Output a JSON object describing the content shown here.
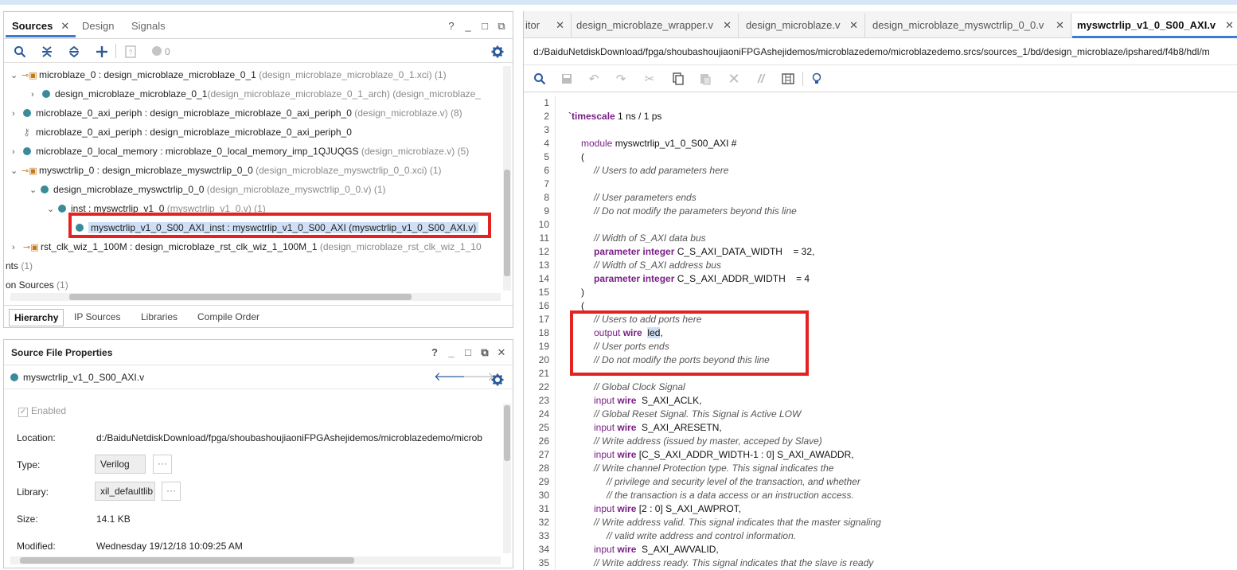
{
  "sources_panel": {
    "tabs": [
      {
        "label": "Sources",
        "active": true
      },
      {
        "label": "Design",
        "active": false
      },
      {
        "label": "Signals",
        "active": false
      }
    ],
    "window_buttons": [
      "?",
      "_",
      "□",
      "⧉"
    ],
    "toolbar": {
      "badge_count": "0"
    },
    "tree": [
      {
        "name": "microblaze_0 : design_microblaze_microblaze_0_1",
        "detail": " (design_microblaze_microblaze_0_1.xci) (1)"
      },
      {
        "name": "design_microblaze_microblaze_0_1",
        "detail": "(design_microblaze_microblaze_0_1_arch) (design_microblaze_"
      },
      {
        "name": "microblaze_0_axi_periph : design_microblaze_microblaze_0_axi_periph_0",
        "detail": " (design_microblaze.v) (8)"
      },
      {
        "name": "microblaze_0_axi_periph : design_microblaze_microblaze_0_axi_periph_0",
        "detail": ""
      },
      {
        "name": "microblaze_0_local_memory : microblaze_0_local_memory_imp_1QJUQGS",
        "detail": " (design_microblaze.v) (5)"
      },
      {
        "name": "myswctrlip_0 : design_microblaze_myswctrlip_0_0",
        "detail": " (design_microblaze_myswctrlip_0_0.xci) (1)"
      },
      {
        "name": "design_microblaze_myswctrlip_0_0",
        "detail": " (design_microblaze_myswctrlip_0_0.v) (1)"
      },
      {
        "name": "inst : myswctrlip_v1_0",
        "detail": " (myswctrlip_v1_0.v) (1)"
      },
      {
        "name": "myswctrlip_v1_0_S00_AXI_inst : myswctrlip_v1_0_S00_AXI (myswctrlip_v1_0_S00_AXI.v)",
        "detail": ""
      },
      {
        "name": "rst_clk_wiz_1_100M : design_microblaze_rst_clk_wiz_1_100M_1",
        "detail": " (design_microblaze_rst_clk_wiz_1_10"
      },
      {
        "name": "nts",
        "detail": " (1)"
      },
      {
        "name": "on Sources",
        "detail": " (1)"
      }
    ],
    "bottom_tabs": [
      {
        "label": "Hierarchy",
        "active": true
      },
      {
        "label": "IP Sources",
        "active": false
      },
      {
        "label": "Libraries",
        "active": false
      },
      {
        "label": "Compile Order",
        "active": false
      }
    ]
  },
  "properties_panel": {
    "title": "Source File Properties",
    "window_buttons": [
      "?",
      "_",
      "□",
      "⧉",
      "✕"
    ],
    "file_name": "myswctrlip_v1_0_S00_AXI.v",
    "enabled_label": "Enabled",
    "rows": [
      {
        "label": "Location:",
        "value": "d:/BaiduNetdiskDownload/fpga/shoubashoujiaoniFPGAshejidemos/microblazedemo/microb"
      },
      {
        "label": "Type:",
        "value": "Verilog"
      },
      {
        "label": "Library:",
        "value": "xil_defaultlib"
      },
      {
        "label": "Size:",
        "value": "14.1 KB"
      },
      {
        "label": "Modified:",
        "value": "Wednesday 19/12/18 10:09:25 AM"
      }
    ],
    "more_button": "···"
  },
  "editor": {
    "tabs": [
      {
        "label": "itor",
        "active": false
      },
      {
        "label": "design_microblaze_wrapper.v",
        "active": false
      },
      {
        "label": "design_microblaze.v",
        "active": false
      },
      {
        "label": "design_microblaze_myswctrlip_0_0.v",
        "active": false
      },
      {
        "label": "myswctrlip_v1_0_S00_AXI.v",
        "active": true
      }
    ],
    "path": "d:/BaiduNetdiskDownload/fpga/shoubashoujiaoniFPGAshejidemos/microblazedemo/microblazedemo.srcs/sources_1/bd/design_microblaze/ipshared/f4b8/hdl/m",
    "line_numbers": [
      "1",
      "2",
      "3",
      "4",
      "5",
      "6",
      "7",
      "8",
      "9",
      "10",
      "11",
      "12",
      "13",
      "14",
      "15",
      "16",
      "17",
      "18",
      "19",
      "20",
      "21",
      "22",
      "23",
      "24",
      "25",
      "26",
      "27",
      "28",
      "29",
      "30",
      "31",
      "32",
      "33",
      "34",
      "35"
    ],
    "code": {
      "l2": "`timescale",
      "l2b": " 1 ns / 1 ps",
      "l4a": "module",
      "l4b": " myswctrlip_v1_0_S00_AXI #",
      "l5": "(",
      "l6": "// Users to add parameters here",
      "l8": "// User parameters ends",
      "l9": "// Do not modify the parameters beyond this line",
      "l11": "// Width of S_AXI data bus",
      "kw_parameter": "parameter",
      "kw_integer": "integer",
      "l12": " C_S_AXI_DATA_WIDTH    = 32,",
      "l13": "// Width of S_AXI address bus",
      "l14": " C_S_AXI_ADDR_WIDTH    = 4",
      "l15": ")",
      "l16": "(",
      "l17": "// Users to add ports here",
      "kw_output": "output",
      "kw_input": "input",
      "kw_wire": "wire",
      "l18_sig": "led",
      "l18_tail": ",",
      "l19": "// User ports ends",
      "l20": "// Do not modify the ports beyond this line",
      "l22": "// Global Clock Signal",
      "l23": "  S_AXI_ACLK,",
      "l24": "// Global Reset Signal. This Signal is Active LOW",
      "l25": "  S_AXI_ARESETN,",
      "l26": "// Write address (issued by master, acceped by Slave)",
      "l27": " [C_S_AXI_ADDR_WIDTH-1 : 0] S_AXI_AWADDR,",
      "l28": "// Write channel Protection type. This signal indicates the",
      "l29": "// privilege and security level of the transaction, and whether",
      "l30": "// the transaction is a data access or an instruction access.",
      "l31": " [2 : 0] S_AXI_AWPROT,",
      "l32": "// Write address valid. This signal indicates that the master signaling",
      "l33": "// valid write address and control information.",
      "l34": "  S_AXI_AWVALID,",
      "l35": "// Write address ready. This signal indicates that the slave is ready"
    }
  }
}
